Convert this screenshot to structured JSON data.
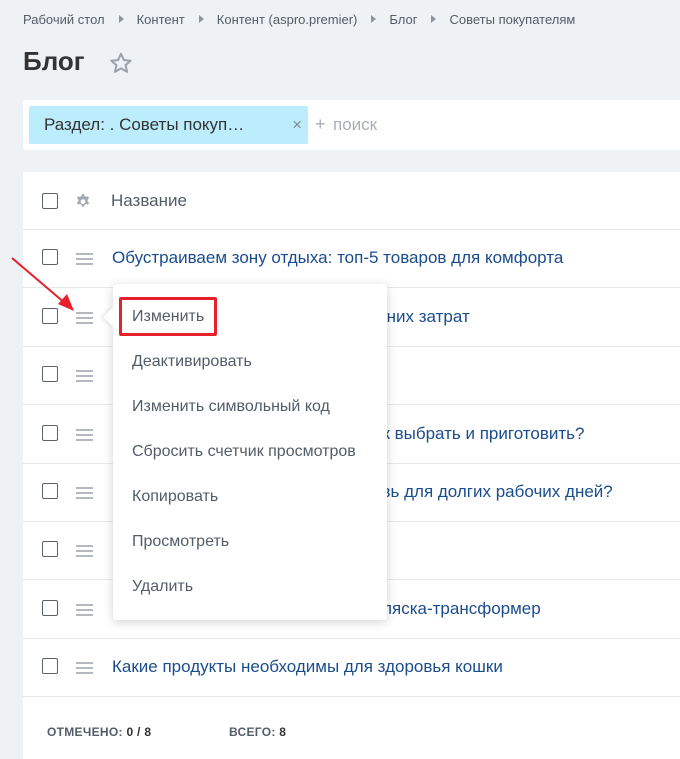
{
  "breadcrumb": {
    "items": [
      "Рабочий стол",
      "Контент",
      "Контент (aspro.premier)",
      "Блог",
      "Советы покупателям"
    ]
  },
  "page": {
    "title": "Блог"
  },
  "filter": {
    "tag_label": "Раздел: . Советы покуп…",
    "tag_close": "×",
    "search_plus": "+",
    "search_placeholder": "поиск",
    "search_value": ""
  },
  "grid": {
    "header_title": "Название",
    "rows": [
      {
        "title": "Обустраиваем зону отдыха: топ-5 товаров для комфорта"
      },
      {
        "title": "шних затрат"
      },
      {
        "title": ""
      },
      {
        "title": "ак выбрать и приготовить?"
      },
      {
        "title": "увь для долгих рабочих дней?"
      },
      {
        "title": ""
      },
      {
        "title": "оляска-трансформер"
      },
      {
        "title": "Какие продукты необходимы для здоровья кошки"
      }
    ],
    "footer": {
      "checked_label": "ОТМЕЧЕНО:",
      "checked_value": "0 / 8",
      "total_label": "ВСЕГО:",
      "total_value": "8"
    }
  },
  "context_menu": {
    "items": [
      "Изменить",
      "Деактивировать",
      "Изменить символьный код",
      "Сбросить счетчик просмотров",
      "Копировать",
      "Просмотреть",
      "Удалить"
    ]
  },
  "colors": {
    "link": "#1a4c8e",
    "filter_tag_bg": "#bcedfc",
    "highlight": "#e8202a",
    "page_bg": "#eef2f4"
  },
  "icons": {
    "star": "star-icon",
    "gear": "gear-icon",
    "row_menu": "hamburger-icon",
    "close": "close-icon",
    "separator": "chevron-right-icon"
  }
}
